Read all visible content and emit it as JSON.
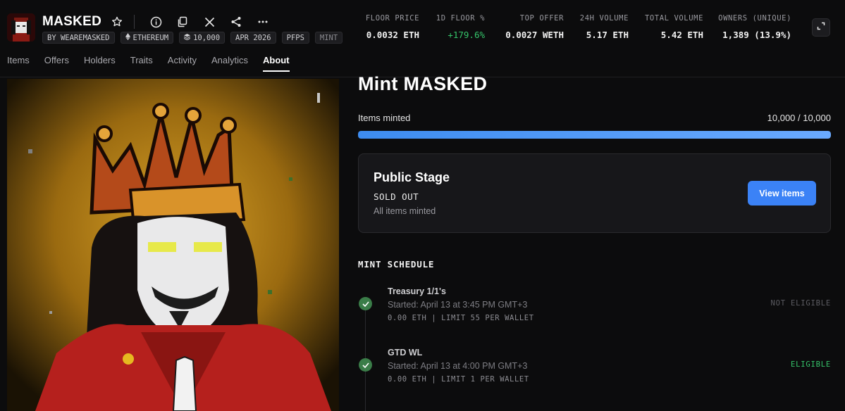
{
  "collection": {
    "name": "MASKED",
    "chips": [
      {
        "label": "BY WEAREMASKED",
        "icon": ""
      },
      {
        "label": "ETHEREUM",
        "icon": "ethereum-icon"
      },
      {
        "label": "10,000",
        "icon": "stack-icon"
      },
      {
        "label": "APR 2026",
        "icon": ""
      },
      {
        "label": "PFPS",
        "icon": ""
      },
      {
        "label": "MINT",
        "icon": ""
      }
    ]
  },
  "header_icons": [
    "star-icon",
    "info-icon",
    "copy-icon",
    "x-logo-icon",
    "share-icon",
    "more-icon"
  ],
  "stats": [
    {
      "label": "FLOOR PRICE",
      "value": "0.0032 ETH"
    },
    {
      "label": "1D FLOOR %",
      "value": "+179.6%",
      "color": "#35c46a"
    },
    {
      "label": "TOP OFFER",
      "value": "0.0027 WETH"
    },
    {
      "label": "24H VOLUME",
      "value": "5.17 ETH"
    },
    {
      "label": "TOTAL VOLUME",
      "value": "5.42 ETH"
    },
    {
      "label": "OWNERS (UNIQUE)",
      "value": "1,389 (13.9%)"
    }
  ],
  "tabs": [
    {
      "label": "Items"
    },
    {
      "label": "Offers"
    },
    {
      "label": "Holders"
    },
    {
      "label": "Traits"
    },
    {
      "label": "Activity"
    },
    {
      "label": "Analytics"
    },
    {
      "label": "About",
      "active": true
    }
  ],
  "mint": {
    "title": "Mint MASKED",
    "minted_label": "Items minted",
    "minted_count": "10,000 / 10,000",
    "progress": 1.0,
    "stage": {
      "title": "Public Stage",
      "status": "SOLD OUT",
      "subtitle": "All items minted",
      "button": "View items"
    },
    "schedule_title": "MINT SCHEDULE",
    "phases": [
      {
        "name": "Treasury 1/1's",
        "started": "Started: April 13 at 3:45 PM GMT+3",
        "detail": "0.00 ETH | LIMIT 55 PER WALLET",
        "eligibility": "NOT ELIGIBLE",
        "eligibility_color": "#5c5c62"
      },
      {
        "name": "GTD WL",
        "started": "Started: April 13 at 4:00 PM GMT+3",
        "detail": "0.00 ETH | LIMIT 1 PER WALLET",
        "eligibility": "ELIGIBLE",
        "eligibility_color": "#35c46a"
      }
    ]
  },
  "colors": {
    "accent": "#3b82f6",
    "positive": "#35c46a",
    "background": "#0c0c0d"
  }
}
